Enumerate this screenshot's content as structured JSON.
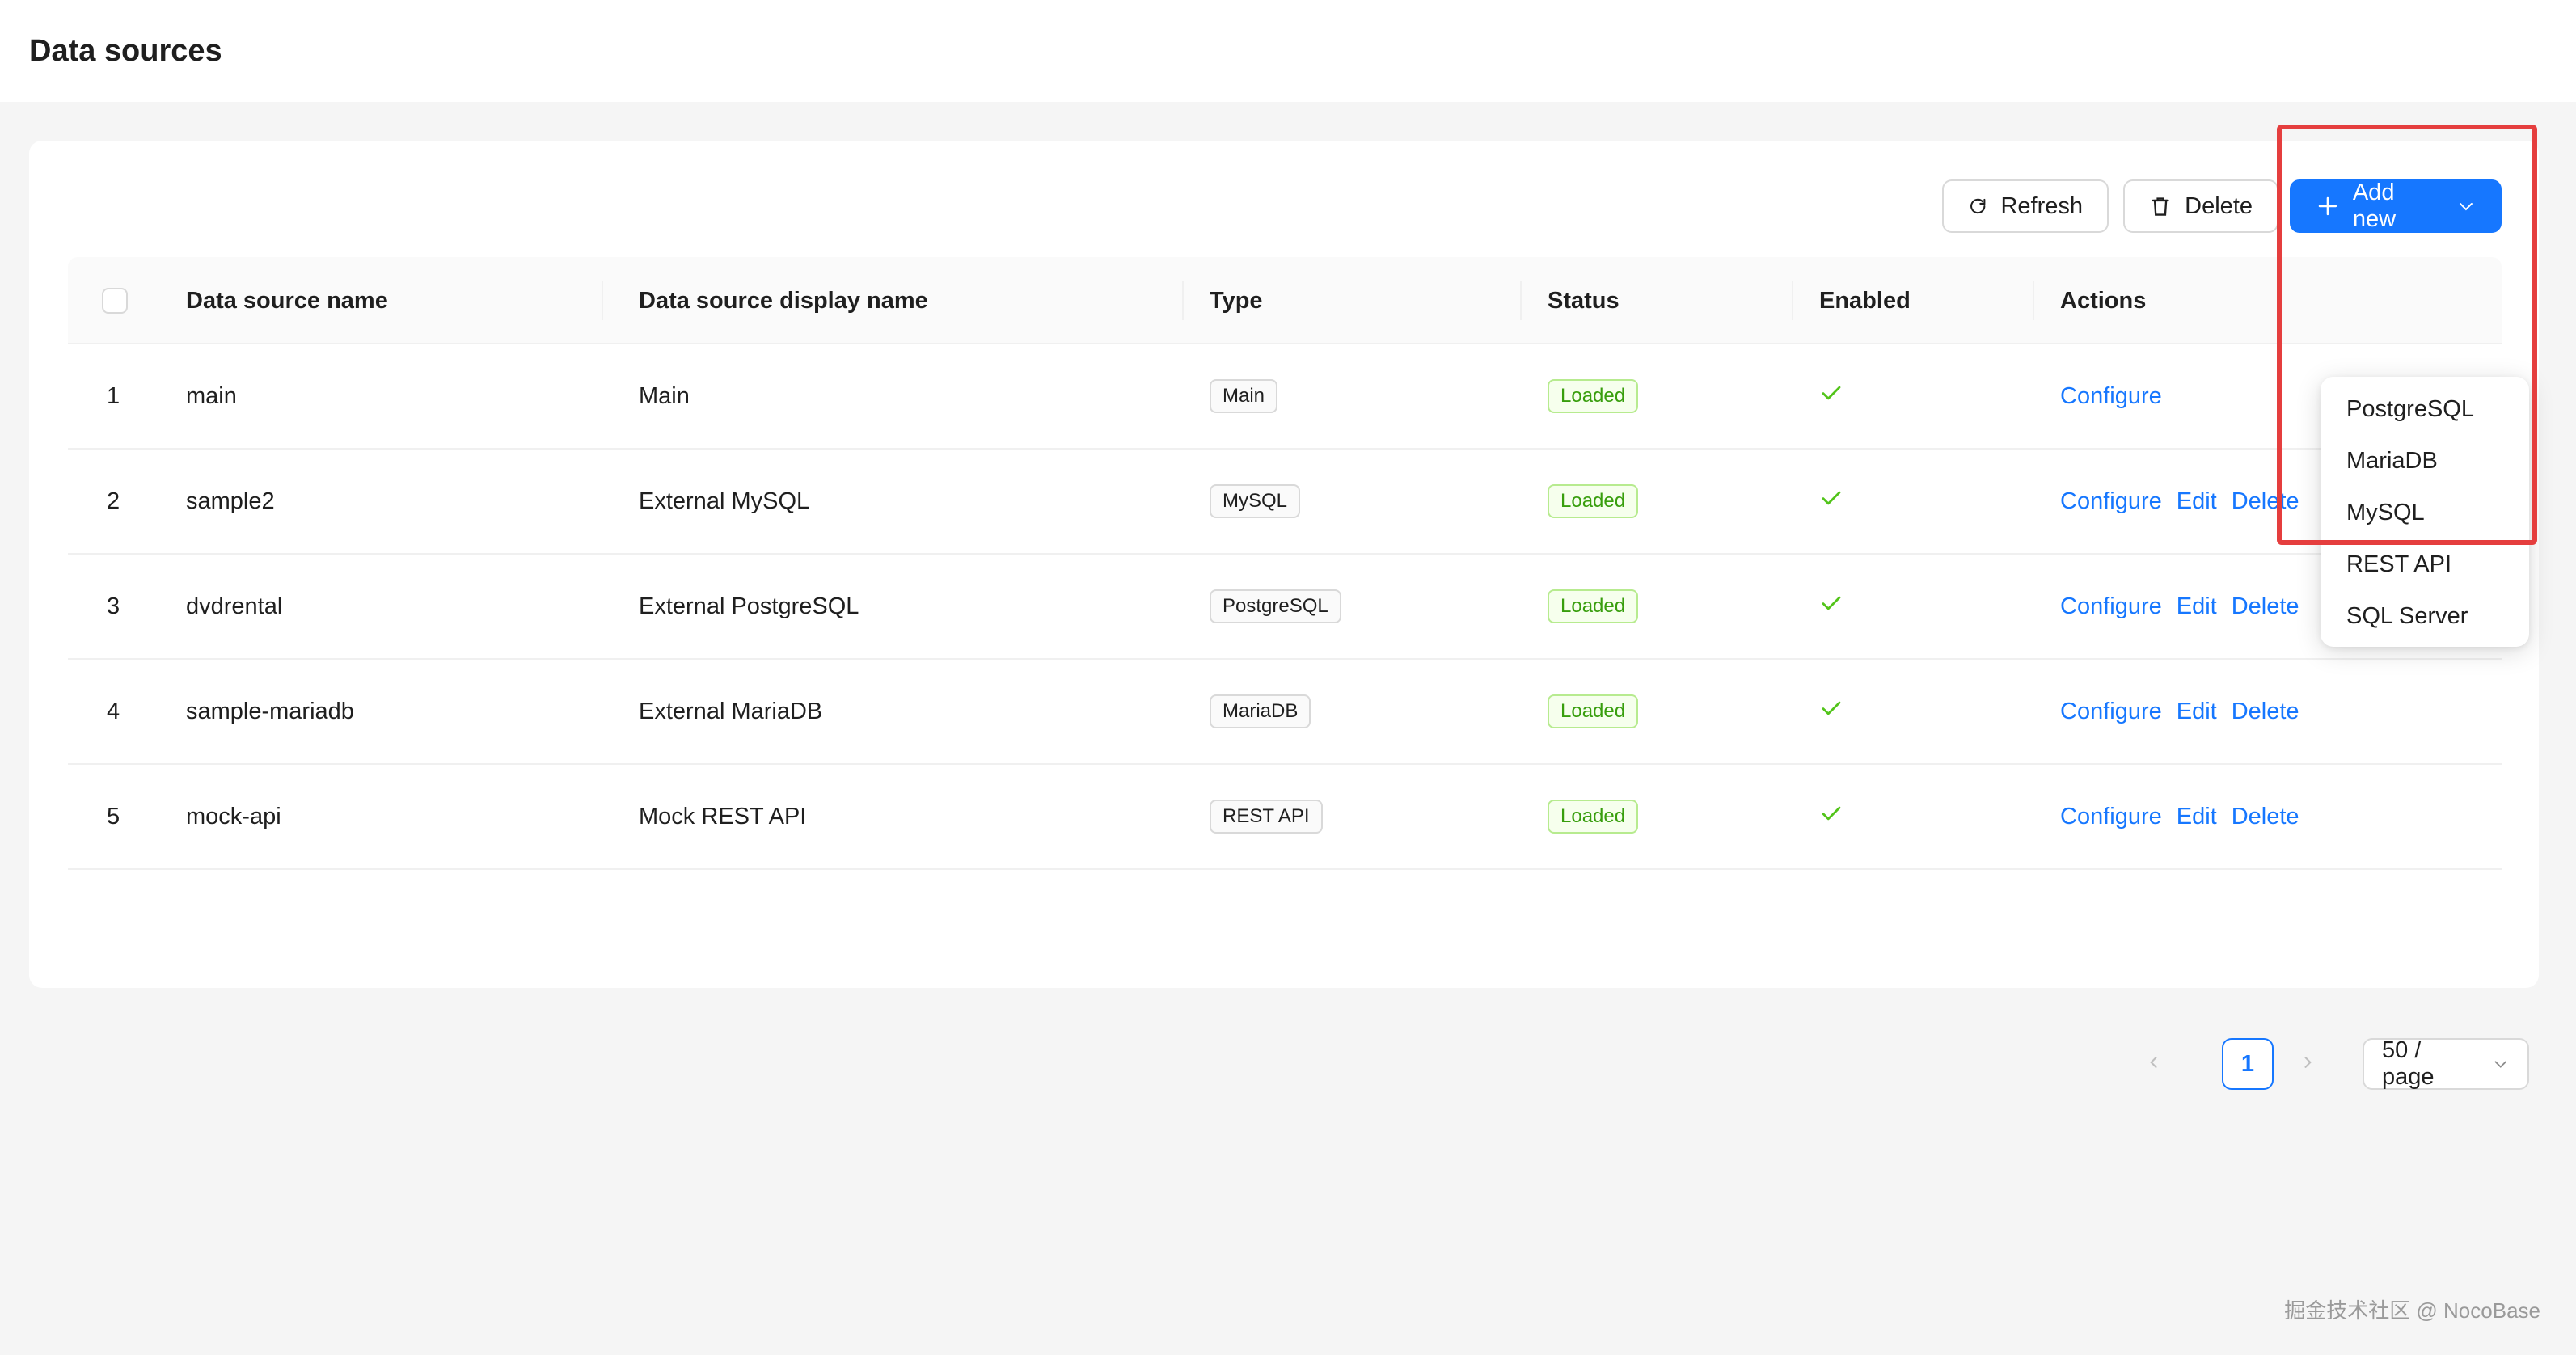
{
  "header": {
    "title": "Data sources"
  },
  "toolbar": {
    "refresh_label": "Refresh",
    "delete_label": "Delete",
    "add_new_label": "Add new"
  },
  "table": {
    "columns": [
      "Data source name",
      "Data source display name",
      "Type",
      "Status",
      "Enabled",
      "Actions"
    ],
    "rows": [
      {
        "index": "1",
        "name": "main",
        "display_name": "Main",
        "type": "Main",
        "status": "Loaded",
        "actions": [
          "Configure"
        ]
      },
      {
        "index": "2",
        "name": "sample2",
        "display_name": "External MySQL",
        "type": "MySQL",
        "status": "Loaded",
        "actions": [
          "Configure",
          "Edit",
          "Delete"
        ]
      },
      {
        "index": "3",
        "name": "dvdrental",
        "display_name": "External PostgreSQL",
        "type": "PostgreSQL",
        "status": "Loaded",
        "actions": [
          "Configure",
          "Edit",
          "Delete"
        ]
      },
      {
        "index": "4",
        "name": "sample-mariadb",
        "display_name": "External MariaDB",
        "type": "MariaDB",
        "status": "Loaded",
        "actions": [
          "Configure",
          "Edit",
          "Delete"
        ]
      },
      {
        "index": "5",
        "name": "mock-api",
        "display_name": "Mock REST API",
        "type": "REST API",
        "status": "Loaded",
        "actions": [
          "Configure",
          "Edit",
          "Delete"
        ]
      }
    ]
  },
  "pagination": {
    "current_page": "1",
    "page_size": "50 / page"
  },
  "add_new_menu": {
    "items": [
      "PostgreSQL",
      "MariaDB",
      "MySQL",
      "REST API",
      "SQL Server"
    ]
  },
  "colors": {
    "primary": "#1677ff",
    "success": "#52c41a",
    "highlight": "#e53e3e"
  },
  "watermark": "掘金技术社区 @ NocoBase"
}
